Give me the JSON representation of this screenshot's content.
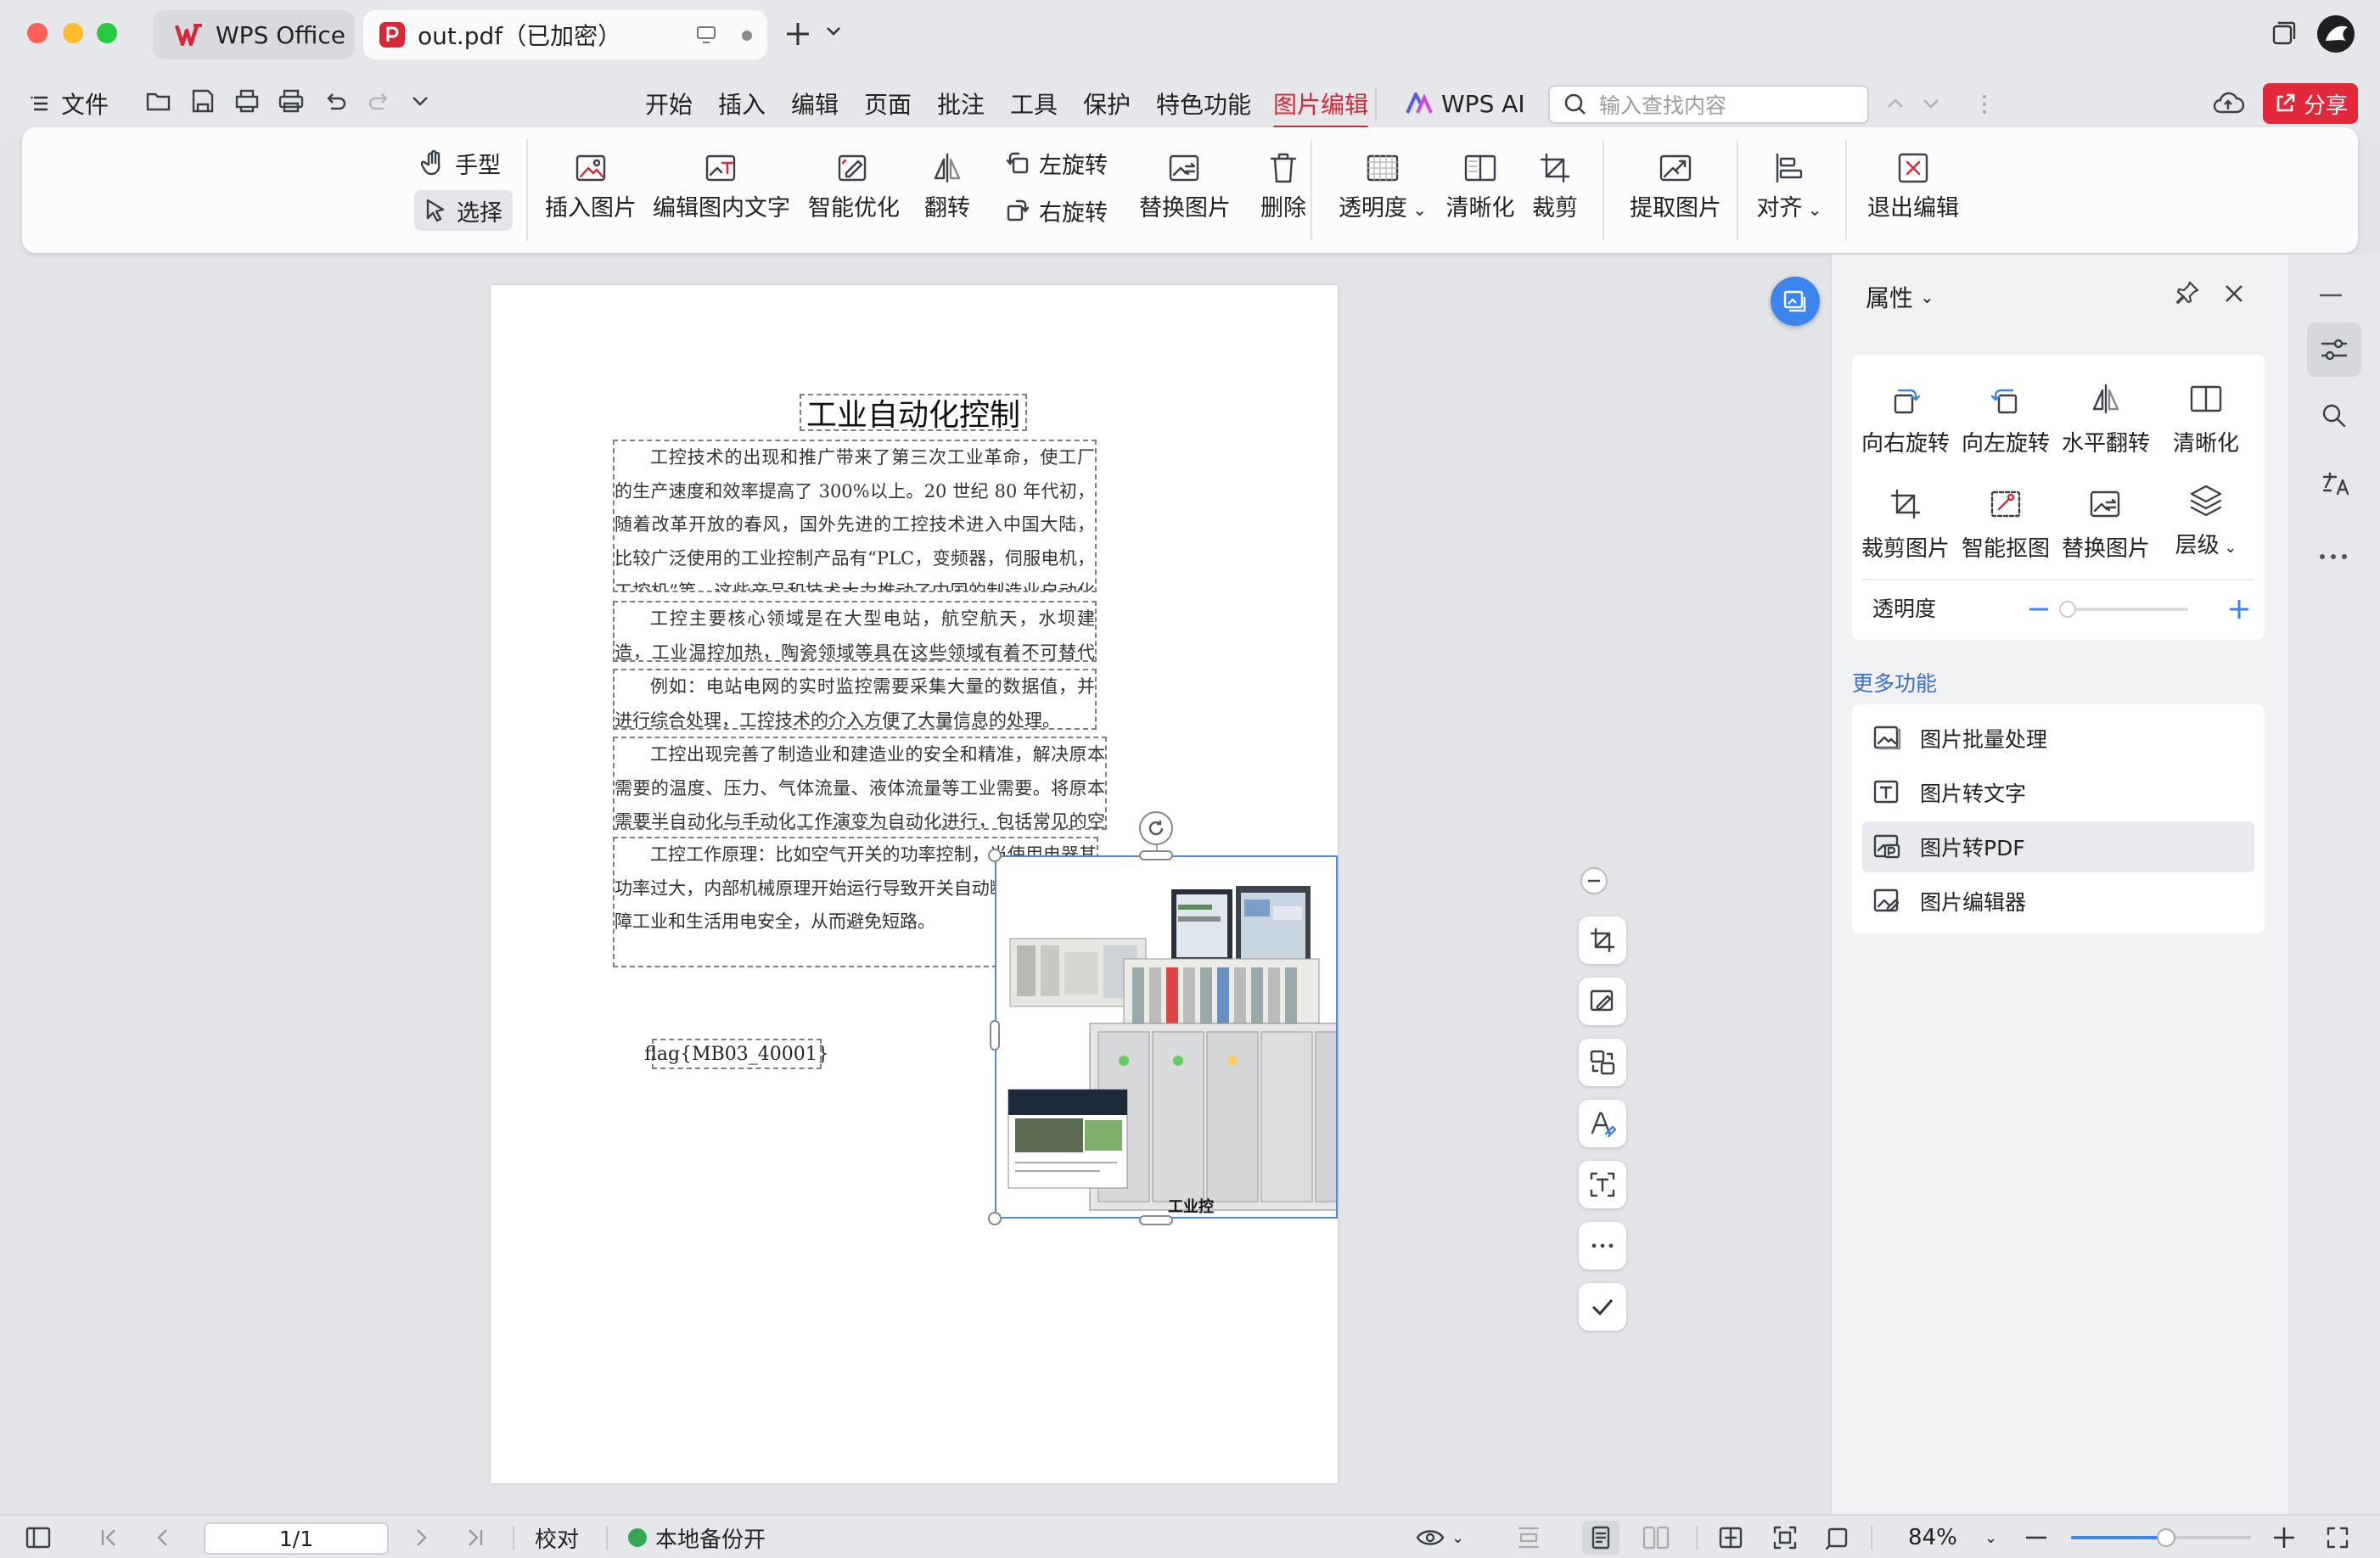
{
  "window": {
    "traffic_lights": {
      "close": "#ff5f57",
      "minimize": "#febc2e",
      "zoom": "#28c840"
    },
    "tabs": [
      {
        "label": "WPS Office",
        "icon": "wps-logo-icon",
        "color": "#d5293a"
      },
      {
        "label": "out.pdf（已加密）",
        "icon": "pdf-file-icon",
        "color": "#d5293a"
      }
    ]
  },
  "menubar": {
    "file_label": "文件",
    "menus": [
      "开始",
      "插入",
      "编辑",
      "页面",
      "批注",
      "工具",
      "保护",
      "特色功能",
      "图片编辑",
      "WPS AI"
    ],
    "active_menu": "图片编辑",
    "search_placeholder": "输入查找内容",
    "share_label": "分享",
    "accent": "#d5293a"
  },
  "ribbon": {
    "hand": "手型",
    "select": "选择",
    "insert_image": "插入图片",
    "edit_text_in_image": "编辑图内文字",
    "smart_optimize": "智能优化",
    "flip": "翻转",
    "rotate_left": "左旋转",
    "rotate_right": "右旋转",
    "replace_image": "替换图片",
    "delete": "删除",
    "transparency": "透明度",
    "sharpen": "清晰化",
    "crop": "裁剪",
    "extract_image": "提取图片",
    "align": "对齐",
    "exit_edit": "退出编辑"
  },
  "document": {
    "title": "工业自动化控制",
    "paragraphs": [
      "工控技术的出现和推广带来了第三次工业革命，使工厂的生产速度和效率提高了 300%以上。20 世纪 80 年代初，随着改革开放的春风，国外先进的工控技术进入中国大陆，比较广泛使用的工业控制产品有“PLC，变频器，伺服电机，工控机”等。这些产品和技术大力推动了中国的制造业自动化进程，为中国现代化的建设作出了巨大的贡献。",
      "工控主要核心领域是在大型电站，航空航天，水坝建造，工业温控加热，陶瓷领域等具在这些领域有着不可替代的优势。",
      "例如：电站电网的实时监控需要采集大量的数据值，并进行综合处理，工控技术的介入方便了大量信息的处理。",
      "工控出现完善了制造业和建造业的安全和精准，解决原本需要的温度、压力、气体流量、液体流量等工业需要。将原本需要半自动化与手动化工作演变为自动化进行，包括常见的空气开关、压力变送器、流量表等。",
      "工控工作原理：比如空气开关的功率控制，当使用电器其功率过大，内部机械原理开始运行导致开关自动断开，以此保障工业和生活用电安全，从而避免短路。"
    ],
    "flag": "flag{MB03_40001}",
    "image_caption": "工业控"
  },
  "panel": {
    "title": "属性",
    "rotate_right": "向右旋转",
    "rotate_left": "向左旋转",
    "flip_horizontal": "水平翻转",
    "sharpen": "清晰化",
    "crop_image": "裁剪图片",
    "smart_cutout": "智能抠图",
    "replace_image": "替换图片",
    "layer": "层级",
    "transparency_label": "透明度",
    "transparency_value": 0.0,
    "more_features_title": "更多功能",
    "more_features": [
      "图片批量处理",
      "图片转文字",
      "图片转PDF",
      "图片编辑器"
    ],
    "highlighted_feature": "图片转PDF"
  },
  "statusbar": {
    "page_indicator": "1/1",
    "proofread": "校对",
    "backup": "本地备份开",
    "zoom": "84%",
    "zoom_slider_value": 0.53
  }
}
